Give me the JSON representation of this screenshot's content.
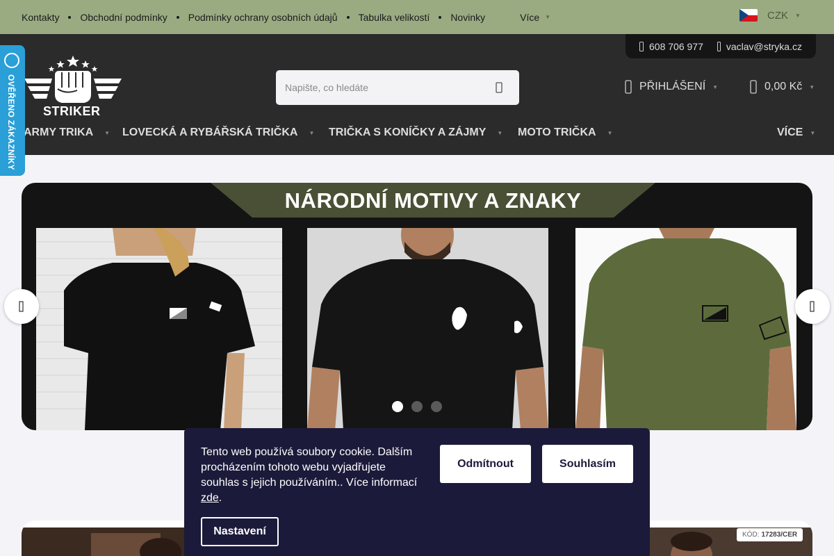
{
  "topbar": {
    "links": [
      "Kontakty",
      "Obchodní podmínky",
      "Podmínky ochrany osobních údajů",
      "Tabulka velikostí",
      "Novinky"
    ],
    "more_label": "Více",
    "currency": "CZK"
  },
  "header": {
    "phone": "608 706 977",
    "email": "vaclav@stryka.cz",
    "logo_text": "STRIKER",
    "search_placeholder": "Napište, co hledáte",
    "login_label": "PŘIHLÁŠENÍ",
    "cart_total": "0,00 Kč"
  },
  "nav": {
    "items": [
      "ARMY TRIKA",
      "LOVECKÁ A RYBÁŘSKÁ TRIČKA",
      "TRIČKA S KONÍČKY A ZÁJMY",
      "MOTO TRIČKA"
    ],
    "more_label": "VÍCE"
  },
  "badge": {
    "label": "OVĚŘENO ZÁKAZNÍKY"
  },
  "slider": {
    "title": "NÁRODNÍ MOTIVY A ZNAKY",
    "slide_count": 3,
    "active_slide": 1
  },
  "product": {
    "code_label": "KÓD:",
    "code_value": "17283/CER"
  },
  "cookie": {
    "text": "Tento web používá soubory cookie. Dalším procházením tohoto webu vyjadřujete souhlas s jejich používáním.. Více informací",
    "link_text": "zde",
    "after_link": ".",
    "reject_label": "Odmítnout",
    "accept_label": "Souhlasím",
    "settings_label": "Nastavení"
  },
  "colors": {
    "topbar": "#9aab82",
    "header": "#2b2b2b",
    "badge": "#2a9fd8",
    "cookie_bg": "#1c1a3a",
    "shirt_olive": "#5d6b3c"
  },
  "icons": [
    "phone-icon",
    "mail-icon",
    "search-icon",
    "user-icon",
    "cart-icon",
    "chevron-down-icon",
    "arrow-left-icon",
    "arrow-right-icon"
  ]
}
